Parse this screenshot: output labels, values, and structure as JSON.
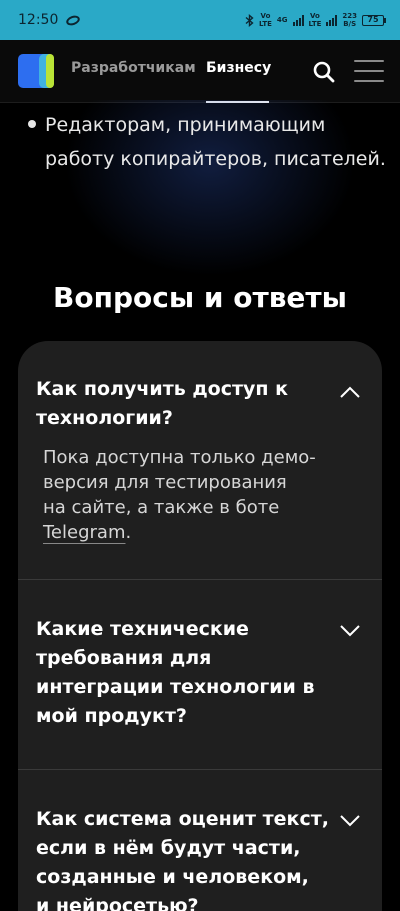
{
  "status_bar": {
    "time": "12:50",
    "net1_top": "Vo",
    "net1_bottom": "LTE",
    "net_4g": "4G",
    "net2_top": "Vo",
    "net2_bottom": "LTE",
    "speed_top": "223",
    "speed_bottom": "B/S",
    "battery": "75"
  },
  "nav": {
    "developers": "Разработчикам",
    "business": "Бизнесу"
  },
  "bullet": {
    "line1": "Редакторам, принимающим",
    "line2": "работу копирайтеров, писателей."
  },
  "faq": {
    "title": "Вопросы и ответы",
    "items": [
      {
        "q1": "Как получить доступ к",
        "q2": "технологии?",
        "expanded": true,
        "a1": "Пока доступна только демо-",
        "a2": "версия для тестирования",
        "a3": "на сайте, а также в боте",
        "link": "Telegram",
        "a_end": "."
      },
      {
        "q1": "Какие технические",
        "q2": "требования для",
        "q3": "интеграции технологии в",
        "q4": "мой продукт?",
        "expanded": false
      },
      {
        "q1": "Как система оценит текст,",
        "q2": "если в нём будут части,",
        "q3": "созданные и человеком,",
        "q4": "и нейросетью?",
        "expanded": false
      }
    ]
  },
  "colors": {
    "status_bar": "#2aa9c7",
    "background": "#000000",
    "card": "#1f1f1f",
    "logo_blue": "#2d6ef0",
    "logo_green": "#b9e336"
  }
}
